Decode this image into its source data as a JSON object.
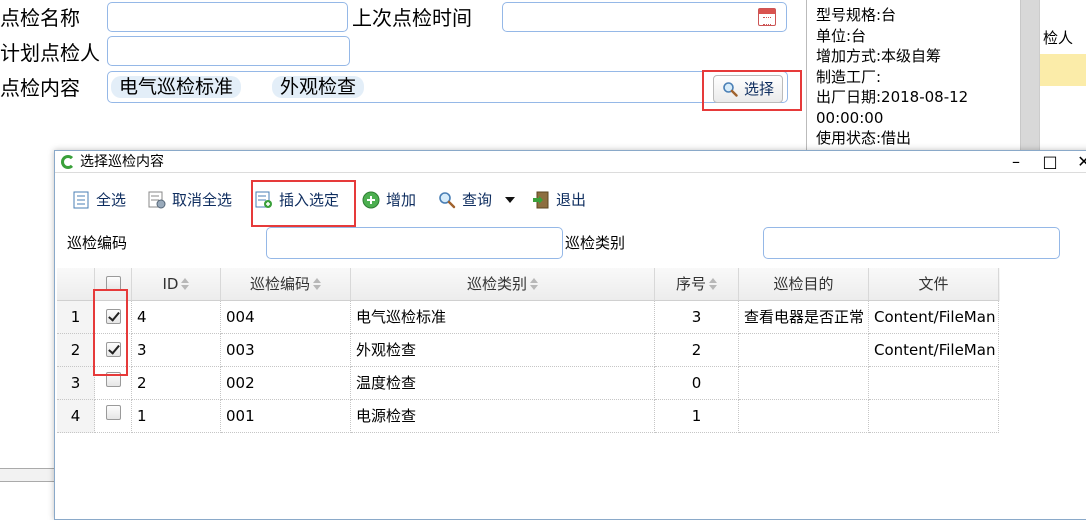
{
  "form": {
    "name_label": "点检名称",
    "name_value": "",
    "last_time_label": "上次点检时间",
    "last_time_value": "",
    "planner_label": "计划点检人",
    "planner_value": "",
    "content_label": "点检内容",
    "content_tags": [
      "电气巡检标准",
      "外观检查"
    ],
    "select_button": "选择"
  },
  "info_panel": {
    "lines": [
      "型号规格:台",
      "单位:台",
      "增加方式:本级自筹",
      "制造工厂:",
      "出厂日期:2018-08-12",
      "00:00:00",
      "使用状态:借出"
    ],
    "partial_header": "检人"
  },
  "dialog": {
    "title": "选择巡检内容",
    "toolbar": {
      "select_all": "全选",
      "deselect_all": "取消全选",
      "insert_selected": "插入选定",
      "add": "增加",
      "query": "查询",
      "exit": "退出"
    },
    "filters": {
      "code_label": "巡检编码",
      "code_value": "",
      "category_label": "巡检类别",
      "category_value": ""
    },
    "grid": {
      "columns": [
        "ID",
        "巡检编码",
        "巡检类别",
        "序号",
        "巡检目的",
        "文件"
      ],
      "rows": [
        {
          "num": "1",
          "checked": true,
          "id": "4",
          "code": "004",
          "category": "电气巡检标准",
          "seq": "3",
          "purpose": "查看电器是否正常",
          "file": "Content/FileMan"
        },
        {
          "num": "2",
          "checked": true,
          "id": "3",
          "code": "003",
          "category": "外观检查",
          "seq": "2",
          "purpose": "",
          "file": "Content/FileMan"
        },
        {
          "num": "3",
          "checked": false,
          "id": "2",
          "code": "002",
          "category": "温度检查",
          "seq": "0",
          "purpose": "",
          "file": ""
        },
        {
          "num": "4",
          "checked": false,
          "id": "1",
          "code": "001",
          "category": "电源检查",
          "seq": "1",
          "purpose": "",
          "file": ""
        }
      ]
    }
  },
  "colors": {
    "highlight": "#e63a3a",
    "accent_blue": "#0e2d5f",
    "field_border": "#95b8e7",
    "selected_row": "#fbeca9"
  }
}
